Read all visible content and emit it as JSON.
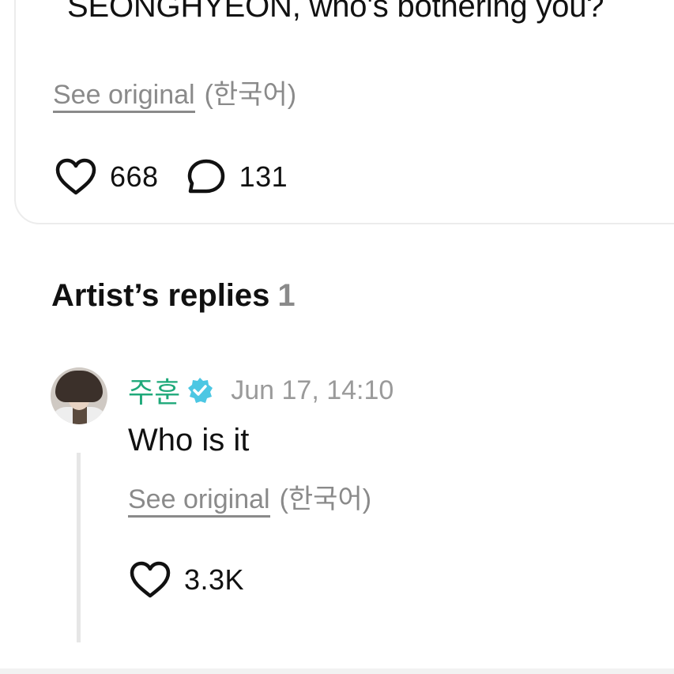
{
  "post": {
    "text": "SEONGHYEON, who's bothering you?",
    "see_original_label": "See original",
    "language": "(한국어)",
    "likes": "668",
    "comments": "131"
  },
  "artist_replies": {
    "heading": "Artist’s replies",
    "count": "1",
    "items": [
      {
        "author": "주훈",
        "verified": true,
        "timestamp": "Jun 17, 14:10",
        "text": "Who is it",
        "see_original_label": "See original",
        "language": "(한국어)",
        "likes": "3.3K"
      }
    ]
  },
  "icons": {
    "like": "heart-outline-icon",
    "comment": "speech-bubble-icon",
    "verified": "verified-badge-icon"
  },
  "colors": {
    "author_name": "#1fa97a",
    "verified_badge": "#4cc7e3",
    "muted_text": "#8a8a8a",
    "thread_line": "#e6e6e6"
  }
}
